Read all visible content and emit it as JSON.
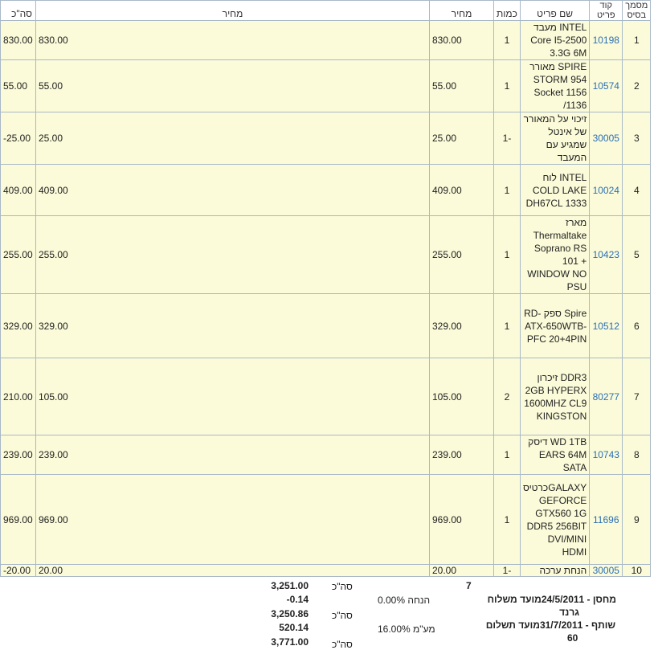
{
  "headers": {
    "basis": "מסמך בסיס",
    "code": "קוד פריט",
    "name": "שם פריט",
    "qty": "כמות",
    "price1": "מחיר",
    "price2": "מחיר",
    "total": "סה\"כ"
  },
  "rows": [
    {
      "n": "1",
      "code": "10198",
      "name": "INTEL מעבד Core I5-2500 3.3G 6M",
      "qty": "1",
      "price1": "830.00",
      "price2": "830.00",
      "total": "830.00"
    },
    {
      "n": "2",
      "code": "10574",
      "name": "SPIRE מאורר STORM 954 Socket 1156 /1136",
      "qty": "1",
      "price1": "55.00",
      "price2": "55.00",
      "total": "55.00"
    },
    {
      "n": "3",
      "code": "30005",
      "name": "זיכוי על המאורר של אינטל שמגיע עם המעבד",
      "qty": "-1",
      "price1": "25.00",
      "price2": "25.00",
      "total": "-25.00"
    },
    {
      "n": "4",
      "code": "10024",
      "name": "INTEL לוח COLD LAKE DH67CL 1333",
      "qty": "1",
      "price1": "409.00",
      "price2": "409.00",
      "total": "409.00"
    },
    {
      "n": "5",
      "code": "10423",
      "name": "מארז Thermaltake Soprano RS 101 + WINDOW NO PSU",
      "qty": "1",
      "price1": "255.00",
      "price2": "255.00",
      "total": "255.00"
    },
    {
      "n": "6",
      "code": "10512",
      "name": "Spire ספק RD-ATX-650WTB-PFC 20+4PIN",
      "qty": "1",
      "price1": "329.00",
      "price2": "329.00",
      "total": "329.00"
    },
    {
      "n": "7",
      "code": "80277",
      "name": "DDR3 זיכרון 2GB HYPERX 1600MHZ CL9 KINGSTON",
      "qty": "2",
      "price1": "105.00",
      "price2": "105.00",
      "total": "210.00"
    },
    {
      "n": "8",
      "code": "10743",
      "name": "WD 1TB דיסק EARS 64M SATA",
      "qty": "1",
      "price1": "239.00",
      "price2": "239.00",
      "total": "239.00"
    },
    {
      "n": "9",
      "code": "11696",
      "name": "GALAXYכרטיס GEFORCE GTX560 1G DDR5 256BIT DVI/MINI HDMI",
      "qty": "1",
      "price1": "969.00",
      "price2": "969.00",
      "total": "969.00"
    },
    {
      "n": "10",
      "code": "30005",
      "name": "הנחת ערכה",
      "qty": "-1",
      "price1": "20.00",
      "price2": "20.00",
      "total": "-20.00"
    }
  ],
  "footer": {
    "qty_total": "7",
    "sum_label1": "סה\"כ",
    "sum1": "3,251.00",
    "discount_label": "הנחה 0.00%",
    "discount": "-0.14",
    "sum_label2": "סה\"כ",
    "sum2": "3,250.86",
    "vat_label": "מע\"מ 16.00%",
    "vat": "520.14",
    "sum_label3": "סה\"כ",
    "sum3": "3,771.00",
    "warehouse_line": "מחסן - 24/5/2011מועד משלוח",
    "warehouse_name": "גרנד",
    "partner_line": "שותף - 31/7/2011מועד תשלום",
    "partner_value": "60"
  }
}
